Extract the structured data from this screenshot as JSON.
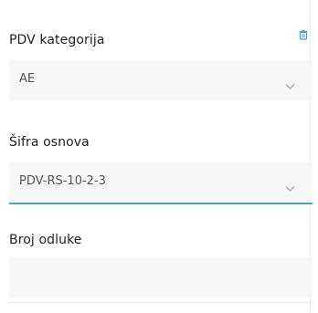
{
  "form": {
    "vat_category": {
      "label": "PDV kategorija",
      "value": "AE"
    },
    "basis_code": {
      "label": "Šifra osnova",
      "value": "PDV-RS-10-2-3"
    },
    "decision_number": {
      "label": "Broj odluke",
      "value": ""
    }
  },
  "icons": {
    "delete": "trash-icon",
    "dropdown": "chevron-down-icon"
  },
  "colors": {
    "accent": "#4aa3c4",
    "field_background": "#f7f7f7",
    "label_text": "#222222",
    "value_text": "#555555"
  }
}
